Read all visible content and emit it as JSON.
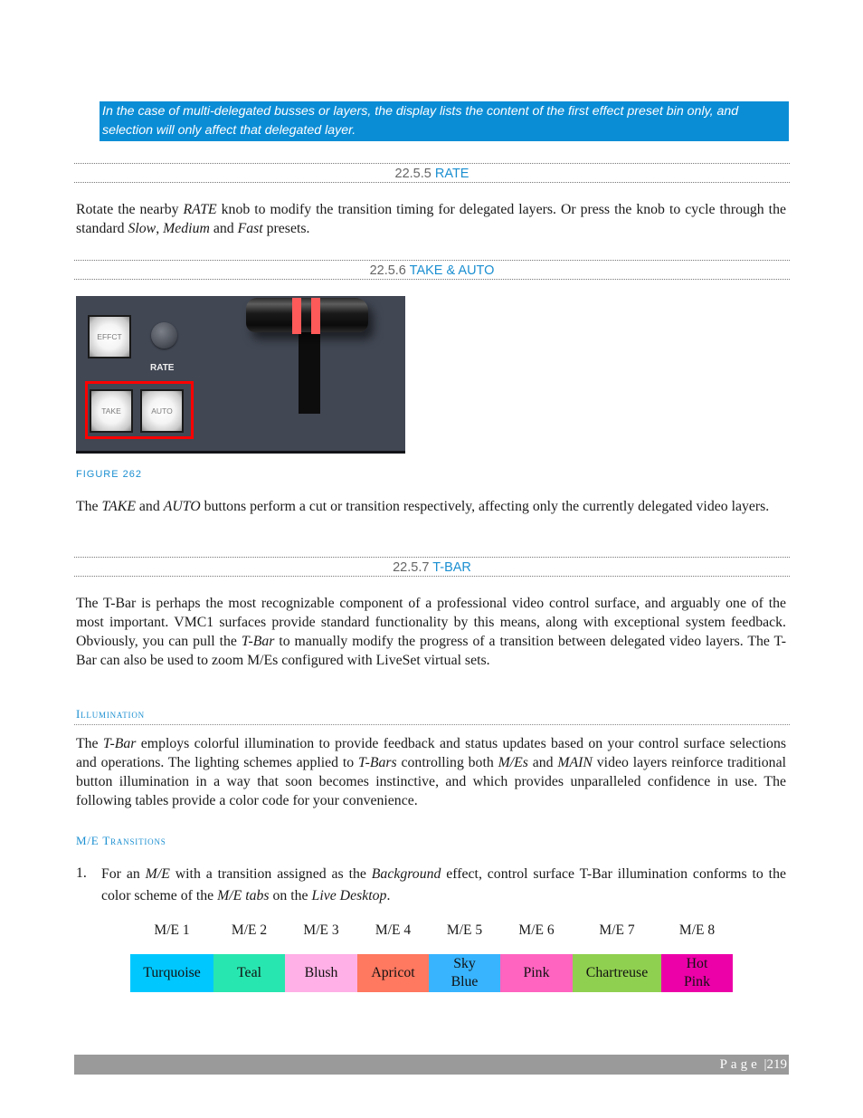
{
  "note": {
    "text": "In the case of multi-delegated busses or layers, the display lists the content of the first effect preset bin only, and selection will only affect that delegated layer.",
    "background_color": "#0b8dd6"
  },
  "sections": {
    "rate": {
      "number": "22.5.5",
      "title": "RATE",
      "body": {
        "p1": "Rotate the nearby ",
        "i1": "RATE",
        "p2": " knob to modify the transition timing for delegated layers.  Or press the knob to cycle through the standard ",
        "i2": "Slow",
        "p3": ", ",
        "i3": "Medium",
        "p4": " and ",
        "i4": "Fast",
        "p5": " presets."
      }
    },
    "take_auto": {
      "number": "22.5.6",
      "title": "TAKE & AUTO",
      "figure": {
        "buttons": {
          "effect": "EFFCT",
          "take": "TAKE",
          "auto": "AUTO"
        },
        "knob_label": "RATE",
        "caption": "FIGURE 262"
      },
      "body": {
        "p1": "The ",
        "i1": "TAKE",
        "p2": " and ",
        "i2": "AUTO",
        "p3": " buttons perform a cut or transition respectively, affecting only the currently delegated video layers."
      }
    },
    "tbar": {
      "number": "22.5.7",
      "title": "T-BAR",
      "body": {
        "p1": "The T-Bar is perhaps the most recognizable component of a professional video control surface, and arguably one of the most important.  VMC1 surfaces provide standard functionality by this means, along with exceptional system feedback. Obviously, you can pull the ",
        "i1": "T-Bar",
        "p2": " to manually modify the progress of a transition between delegated video layers.  The T-Bar can also be used to zoom M/Es configured with LiveSet virtual sets."
      },
      "illumination": {
        "heading": "Illumination",
        "body": {
          "p1": "The ",
          "i1": "T-Bar",
          "p2": " employs colorful illumination to provide feedback and status updates based on your control surface selections and operations.  The lighting schemes applied to ",
          "i2": "T-Bars",
          "p3": " controlling both ",
          "i3": "M/Es",
          "p4": " and ",
          "i4": "MAIN",
          "p5": " video layers reinforce traditional button illumination in a way that soon becomes instinctive, and which provides unparalleled confidence in use. The following tables provide a color code for your convenience."
        }
      },
      "me_transitions": {
        "heading": "M/E Transitions",
        "list": [
          {
            "num": "1.",
            "p1": "For an ",
            "i1": "M/E",
            "p2": " with a transition assigned as the ",
            "i2": "Background",
            "p3": " effect, control surface T-Bar illumination conforms to the color scheme of the ",
            "i3": "M/E tabs",
            "p4": " on the ",
            "i4": "Live Desktop",
            "p5": "."
          }
        ],
        "table": [
          {
            "me": "M/E 1",
            "color_name": "Turquoise",
            "color": "#00c8ff"
          },
          {
            "me": "M/E 2",
            "color_name": "Teal",
            "color": "#28e6b0"
          },
          {
            "me": "M/E 3",
            "color_name": "Blush",
            "color": "#ffb0e6"
          },
          {
            "me": "M/E 4",
            "color_name": "Apricot",
            "color": "#ff7860"
          },
          {
            "me": "M/E 5",
            "color_name": "Sky Blue",
            "color": "#38b4ff"
          },
          {
            "me": "M/E 6",
            "color_name": "Pink",
            "color": "#ff64c0"
          },
          {
            "me": "M/E 7",
            "color_name": "Chartreuse",
            "color": "#90d050"
          },
          {
            "me": "M/E 8",
            "color_name": "Hot Pink",
            "color": "#ec00a8"
          }
        ]
      }
    }
  },
  "footer": {
    "page_label": "Page",
    "separator": "|",
    "page_number": "219"
  },
  "colors": {
    "heading_accent": "#1b8fd1",
    "footer_bar": "#9a9a9a"
  }
}
